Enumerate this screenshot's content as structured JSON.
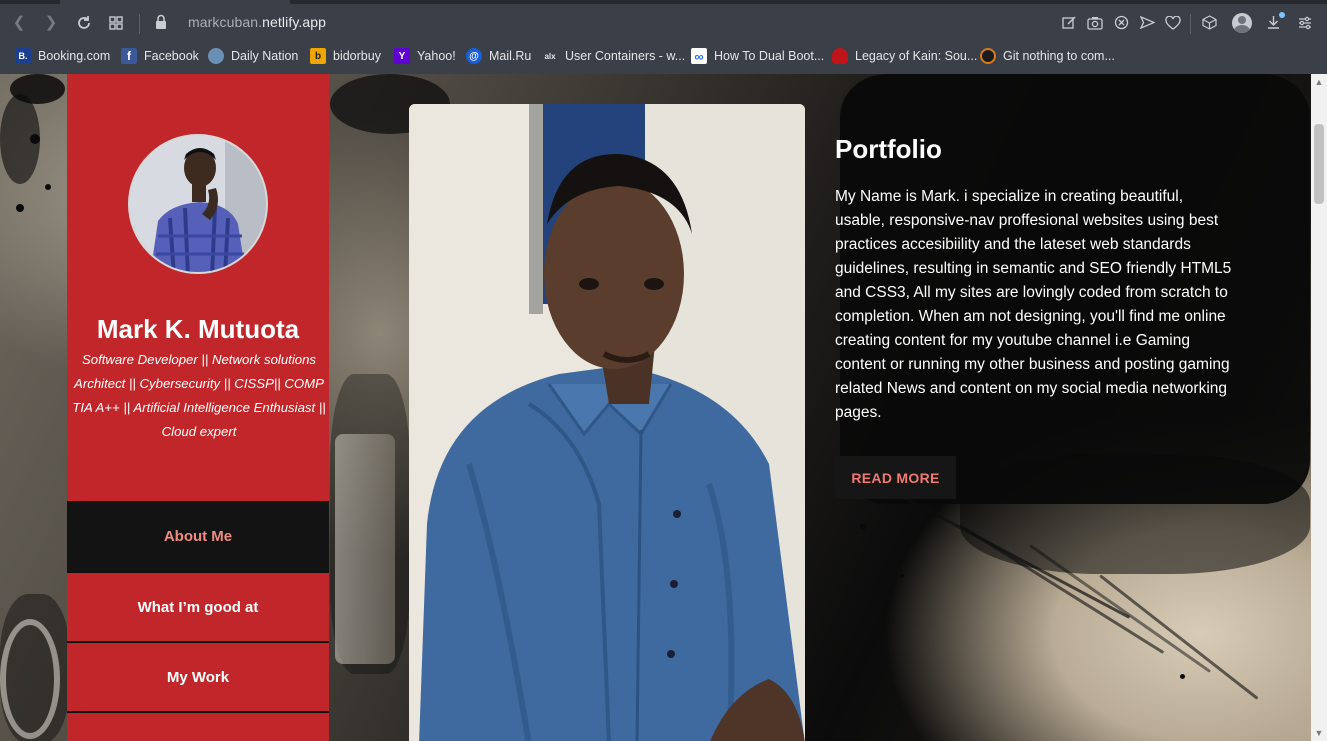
{
  "browser": {
    "url_prefix": "markcuban.",
    "url_host": "netlify.app",
    "bookmarks": [
      {
        "label": "Booking.com",
        "icon": "B.",
        "color": "#1d3f8f"
      },
      {
        "label": "Facebook",
        "icon": "f",
        "color": "#3b5998"
      },
      {
        "label": "Daily Nation",
        "icon": "",
        "color": "#6b8fb5"
      },
      {
        "label": "bidorbuy",
        "icon": "b",
        "color": "#f0a500"
      },
      {
        "label": "Yahoo!",
        "icon": "Y",
        "color": "#5f01d1"
      },
      {
        "label": "Mail.Ru",
        "icon": "@",
        "color": "#1a5fd6"
      },
      {
        "label": "User Containers - w...",
        "icon": "alx",
        "color": "#3b3f47"
      },
      {
        "label": "How To Dual Boot...",
        "icon": "∞",
        "color": "#2f6fe0"
      },
      {
        "label": "Legacy of Kain: Sou...",
        "icon": "",
        "color": "#c0141b"
      },
      {
        "label": "Git nothing to com...",
        "icon": "",
        "color": "#d87a1b"
      }
    ]
  },
  "sidebar": {
    "name": "Mark K. Mutuota",
    "tagline": "Software Developer || Network solutions Architect || Cybersecurity || CISSP|| COMP TIA A++ || Artificial Intelligence Enthusiast || Cloud expert",
    "nav": [
      {
        "label": "About Me"
      },
      {
        "label": "What I’m good at"
      },
      {
        "label": "My Work"
      }
    ]
  },
  "main": {
    "heading": "Portfolio",
    "paragraph": "My Name is Mark. i specialize in creating beautiful, usable, responsive-nav proffesional websites using best practices accesibiility and the lateset web standards guidelines, resulting in semantic and SEO friendly HTML5 and CSS3, All my sites are lovingly coded from scratch to completion. When am not designing, you'll find me online creating content for my youtube channel i.e Gaming content or running my other business and posting gaming related News and content on my social media networking pages.",
    "button": "READ MORE"
  }
}
